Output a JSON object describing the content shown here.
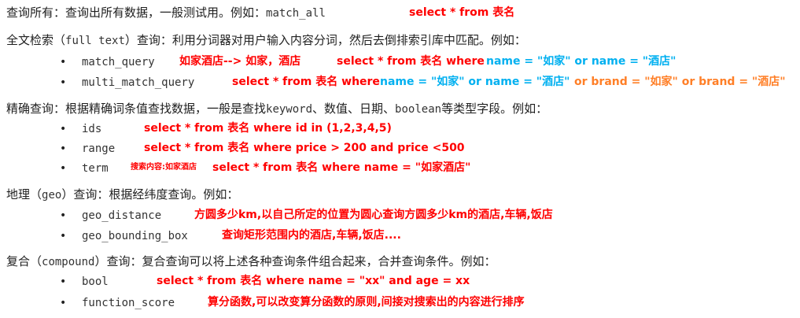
{
  "colors": {
    "text": "#1f1f1f",
    "red": "#ff0000",
    "blue": "#00b0f0",
    "orange": "#ff7f27"
  },
  "lines": {
    "s1_prefix": "查询所有：查询出所有数据，一般测试用。例如：",
    "s1_term": "match_all",
    "s1_sql": "select * from 表名",
    "s2_prefix": "全文检索（",
    "s2_term": "full text",
    "s2_suffix": "）查询：利用分词器对用户输入内容分词，然后去倒排索引库中匹配。例如：",
    "mq_term": "match_query",
    "mq_red1": "如家酒店--> 如家，酒店",
    "mq_red2": "select * from 表名 where",
    "mq_blue": "name = \"如家\" or name = \"酒店\"",
    "mmq_term": "multi_match_query",
    "mmq_red": "select * from 表名 where",
    "mmq_blue": "name = \"如家\" or name = \"酒店\"",
    "mmq_orange": "or brand = \"如家\" or brand = \"酒店\"",
    "s3_prefix": "精确查询：根据精确词条值查找数据，一般是查找",
    "s3_kw": "keyword",
    "s3_mid": "、数值、日期、",
    "s3_bool": "boolean",
    "s3_suffix": "等类型字段。例如：",
    "ids_term": "ids",
    "ids_sql": "select * from 表名 where id in (1,2,3,4,5)",
    "range_term": "range",
    "range_sql": "select * from 表名 where price > 200 and price <500",
    "term_term": "term",
    "term_tiny": "搜索内容:如家酒店",
    "term_sql": "select * from 表名 where name = \"如家酒店\"",
    "s4_prefix": "地理（",
    "s4_term": "geo",
    "s4_suffix": "）查询：根据经纬度查询。例如：",
    "gd_term": "geo_distance",
    "gd_desc": "方圆多少km,以自己所定的位置为圆心查询方圆多少km的酒店,车辆,饭店",
    "gbb_term": "geo_bounding_box",
    "gbb_desc": "查询矩形范围内的酒店,车辆,饭店....",
    "s5_prefix": "复合（",
    "s5_term": "compound",
    "s5_suffix": "）查询：复合查询可以将上述各种查询条件组合起来，合并查询条件。例如：",
    "bool_term": "bool",
    "bool_sql": "select * from 表名 where name = \"xx\" and age = xx",
    "fs_term": "function_score",
    "fs_desc": "算分函数,可以改变算分函数的原则,间接对搜索出的内容进行排序"
  },
  "bullet_char": "•"
}
